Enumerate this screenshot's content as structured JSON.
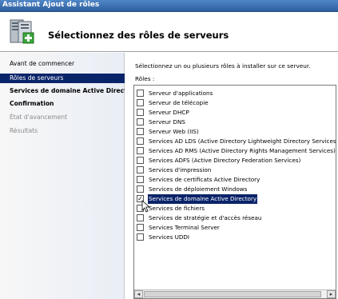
{
  "window": {
    "title": "Assistant Ajout de rôles"
  },
  "header": {
    "title": "Sélectionnez des rôles de serveurs",
    "icon": "server-add-icon"
  },
  "nav": {
    "items": [
      {
        "label": "Avant de commencer",
        "state": "normal"
      },
      {
        "label": "Rôles de serveurs",
        "state": "selected"
      },
      {
        "label": "Services de domaine Active Directo...",
        "state": "bold"
      },
      {
        "label": "Confirmation",
        "state": "bold"
      },
      {
        "label": "État d'avancement",
        "state": "disabled"
      },
      {
        "label": "Résultats",
        "state": "disabled"
      }
    ]
  },
  "content": {
    "instruction": "Sélectionnez un ou plusieurs rôles à installer sur ce serveur.",
    "roles_label": "Rôles :",
    "roles": [
      {
        "label": "Serveur d'applications",
        "checked": false
      },
      {
        "label": "Serveur de télécopie",
        "checked": false
      },
      {
        "label": "Serveur DHCP",
        "checked": false
      },
      {
        "label": "Serveur DNS",
        "checked": false
      },
      {
        "label": "Serveur Web (IIS)",
        "checked": false
      },
      {
        "label": "Services AD LDS (Active Directory Lightweight Directory Services)",
        "checked": false
      },
      {
        "label": "Services AD RMS (Active Directory Rights Management Services)",
        "checked": false
      },
      {
        "label": "Services ADFS (Active Directory Federation Services)",
        "checked": false
      },
      {
        "label": "Services d'impression",
        "checked": false
      },
      {
        "label": "Services de certificats Active Directory",
        "checked": false
      },
      {
        "label": "Services de déploiement Windows",
        "checked": false
      },
      {
        "label": "Services de domaine Active Directory",
        "checked": true,
        "selected": true
      },
      {
        "label": "Services de fichiers",
        "checked": false
      },
      {
        "label": "Services de stratégie et d'accès réseau",
        "checked": false
      },
      {
        "label": "Services Terminal Server",
        "checked": false
      },
      {
        "label": "Services UDDI",
        "checked": false
      }
    ],
    "scroll": {
      "left_arrow": "◂",
      "right_arrow": "▸"
    }
  },
  "check_mark": "✓"
}
